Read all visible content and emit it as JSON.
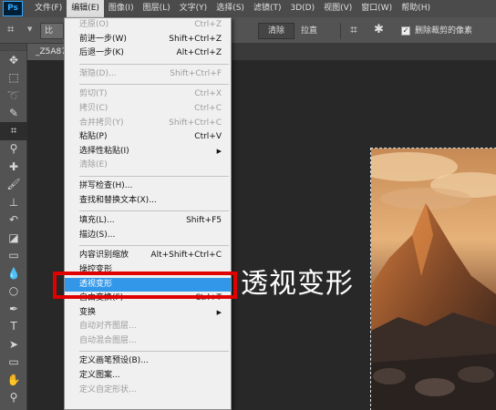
{
  "app": {
    "logo": "Ps"
  },
  "menubar": {
    "items": [
      "文件(F)",
      "编辑(E)",
      "图像(I)",
      "图层(L)",
      "文字(Y)",
      "选择(S)",
      "滤镜(T)",
      "3D(D)",
      "视图(V)",
      "窗口(W)",
      "帮助(H)"
    ],
    "active_index": 1
  },
  "options": {
    "ratio_label": "比",
    "clear_label": "清除",
    "straighten_label": "拉直",
    "delete_cropped_checked": true,
    "delete_cropped_label": "删除裁剪的像素"
  },
  "document": {
    "tab_title": "_Z5A87"
  },
  "toolbox": {
    "tools": [
      {
        "name": "move-tool-icon",
        "glyph": "✥"
      },
      {
        "name": "marquee-tool-icon",
        "glyph": "⬚"
      },
      {
        "name": "lasso-tool-icon",
        "glyph": "➰"
      },
      {
        "name": "quick-select-tool-icon",
        "glyph": "✎"
      },
      {
        "name": "crop-tool-icon",
        "glyph": "⌗"
      },
      {
        "name": "eyedropper-tool-icon",
        "glyph": "⚲"
      },
      {
        "name": "healing-brush-tool-icon",
        "glyph": "✚"
      },
      {
        "name": "brush-tool-icon",
        "glyph": "🖌"
      },
      {
        "name": "clone-stamp-tool-icon",
        "glyph": "⊥"
      },
      {
        "name": "history-brush-tool-icon",
        "glyph": "↶"
      },
      {
        "name": "eraser-tool-icon",
        "glyph": "◪"
      },
      {
        "name": "gradient-tool-icon",
        "glyph": "▭"
      },
      {
        "name": "blur-tool-icon",
        "glyph": "💧"
      },
      {
        "name": "dodge-tool-icon",
        "glyph": "○"
      },
      {
        "name": "pen-tool-icon",
        "glyph": "✒"
      },
      {
        "name": "type-tool-icon",
        "glyph": "T"
      },
      {
        "name": "path-select-tool-icon",
        "glyph": "➤"
      },
      {
        "name": "rectangle-tool-icon",
        "glyph": "▭"
      },
      {
        "name": "hand-tool-icon",
        "glyph": "✋"
      },
      {
        "name": "zoom-tool-icon",
        "glyph": "⚲"
      }
    ],
    "selected_index": 4
  },
  "edit_menu": {
    "items": [
      {
        "label": "还原(O)",
        "shortcut": "Ctrl+Z",
        "disabled": true
      },
      {
        "label": "前进一步(W)",
        "shortcut": "Shift+Ctrl+Z"
      },
      {
        "label": "后退一步(K)",
        "shortcut": "Alt+Ctrl+Z"
      },
      {
        "sep": true
      },
      {
        "label": "渐隐(D)...",
        "shortcut": "Shift+Ctrl+F",
        "disabled": true
      },
      {
        "sep": true
      },
      {
        "label": "剪切(T)",
        "shortcut": "Ctrl+X",
        "disabled": true
      },
      {
        "label": "拷贝(C)",
        "shortcut": "Ctrl+C",
        "disabled": true
      },
      {
        "label": "合并拷贝(Y)",
        "shortcut": "Shift+Ctrl+C",
        "disabled": true
      },
      {
        "label": "粘贴(P)",
        "shortcut": "Ctrl+V"
      },
      {
        "label": "选择性粘贴(I)",
        "shortcut": "",
        "submenu": true
      },
      {
        "label": "清除(E)",
        "shortcut": "",
        "disabled": true
      },
      {
        "sep": true
      },
      {
        "label": "拼写检查(H)...",
        "shortcut": ""
      },
      {
        "label": "查找和替换文本(X)...",
        "shortcut": ""
      },
      {
        "sep": true
      },
      {
        "label": "填充(L)...",
        "shortcut": "Shift+F5"
      },
      {
        "label": "描边(S)...",
        "shortcut": ""
      },
      {
        "sep": true
      },
      {
        "label": "内容识别缩放",
        "shortcut": "Alt+Shift+Ctrl+C"
      },
      {
        "label": "操控变形",
        "shortcut": ""
      },
      {
        "label": "透视变形",
        "shortcut": "",
        "highlight": true
      },
      {
        "label": "自由变换(F)",
        "shortcut": "Ctrl+T"
      },
      {
        "label": "变换",
        "shortcut": "",
        "submenu": true
      },
      {
        "label": "自动对齐图层...",
        "shortcut": "",
        "disabled": true
      },
      {
        "label": "自动混合图层...",
        "shortcut": "",
        "disabled": true
      },
      {
        "sep": true
      },
      {
        "label": "定义画笔预设(B)...",
        "shortcut": ""
      },
      {
        "label": "定义图案...",
        "shortcut": ""
      },
      {
        "label": "定义自定形状...",
        "shortcut": "",
        "disabled": true
      }
    ]
  },
  "annotation": {
    "label": "透视变形",
    "color": "#e00000"
  },
  "colors": {
    "menu_highlight": "#3297e8",
    "ps_accent": "#31a8ff"
  }
}
